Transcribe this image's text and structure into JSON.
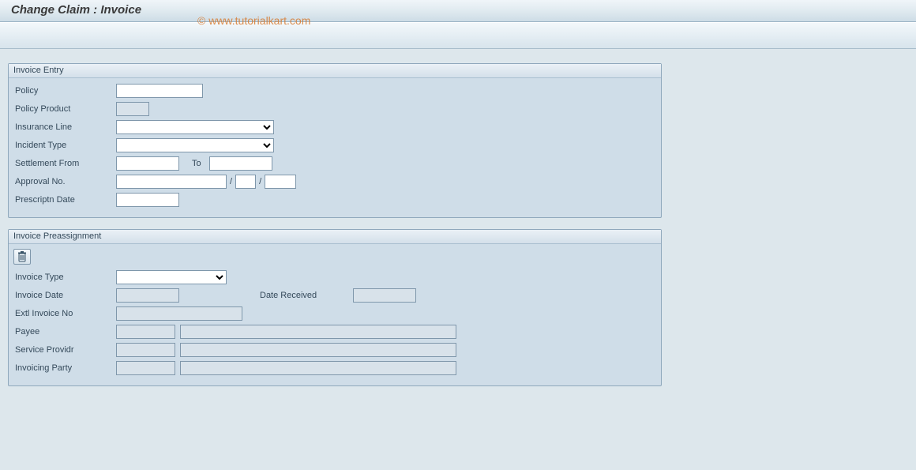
{
  "header": {
    "title": "Change Claim : Invoice"
  },
  "watermark": "© www.tutorialkart.com",
  "panel1": {
    "title": "Invoice Entry",
    "labels": {
      "policy": "Policy",
      "policy_product": "Policy Product",
      "insurance_line": "Insurance Line",
      "incident_type": "Incident Type",
      "settlement_from": "Settlement From",
      "to": "To",
      "approval_no": "Approval No.",
      "prescriptn_date": "Prescriptn Date"
    },
    "values": {
      "policy": "",
      "policy_product": "",
      "insurance_line": "",
      "incident_type": "",
      "settlement_from": "",
      "settlement_to": "",
      "approval_no_1": "",
      "approval_no_2": "",
      "approval_no_3": "",
      "prescriptn_date": ""
    }
  },
  "panel2": {
    "title": "Invoice Preassignment",
    "labels": {
      "invoice_type": "Invoice Type",
      "invoice_date": "Invoice Date",
      "date_received": "Date Received",
      "extl_invoice_no": "Extl Invoice No",
      "payee": "Payee",
      "service_providr": "Service Providr",
      "invoicing_party": "Invoicing Party"
    },
    "values": {
      "invoice_type": "",
      "invoice_date": "",
      "date_received": "",
      "extl_invoice_no": "",
      "payee_code": "",
      "payee_name": "",
      "service_providr_code": "",
      "service_providr_name": "",
      "invoicing_party_code": "",
      "invoicing_party_name": ""
    }
  }
}
